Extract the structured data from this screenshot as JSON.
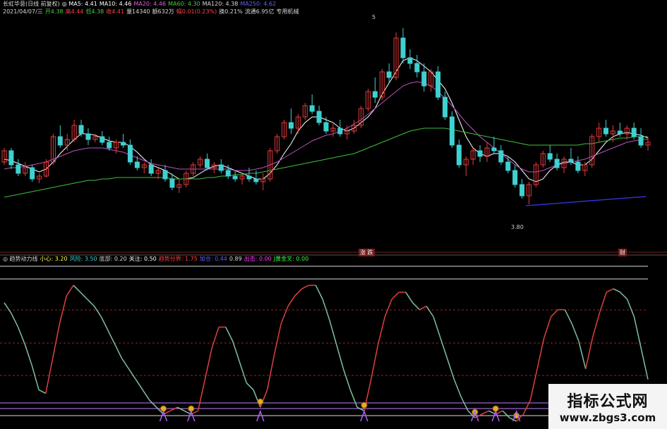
{
  "header": {
    "row1": [
      {
        "text": "长虹华意(日线 前复权)",
        "color": "#d8d8d8"
      },
      {
        "text": "◎ MA5: 4.41",
        "color": "#ffffff"
      },
      {
        "text": "MA10: 4.46",
        "color": "#ffffff"
      },
      {
        "text": "MA20: 4.46",
        "color": "#e060e0"
      },
      {
        "text": "MA60: 4.30",
        "color": "#40d040"
      },
      {
        "text": "MA120: 4.38",
        "color": "#d8d8d8"
      },
      {
        "text": "MA250: 4.62",
        "color": "#6060ff"
      }
    ],
    "row2": [
      {
        "text": "2021/04/07/三",
        "color": "#d8d8d8"
      },
      {
        "text": "开4.38",
        "color": "#40d040"
      },
      {
        "text": "高4.44",
        "color": "#ff4040"
      },
      {
        "text": "低4.38",
        "color": "#40d040"
      },
      {
        "text": "收4.41",
        "color": "#ff4040"
      },
      {
        "text": "量14340",
        "color": "#d8d8d8"
      },
      {
        "text": "额632万",
        "color": "#d8d8d8"
      },
      {
        "text": "幅0.01(0.23%)",
        "color": "#ff4040"
      },
      {
        "text": "换0.21%",
        "color": "#d8d8d8"
      },
      {
        "text": "流通6.95亿",
        "color": "#d8d8d8"
      },
      {
        "text": "专用机械",
        "color": "#d8d8d8"
      }
    ],
    "row3": [
      {
        "text": "◎ 趋势动力线",
        "color": "#d8d8d8"
      },
      {
        "text": "小心: 3.20",
        "color": "#ffff40"
      },
      {
        "text": "风险: 3.50",
        "color": "#40d0d0"
      },
      {
        "text": "底部: 0.20",
        "color": "#d8d8d8"
      },
      {
        "text": "关注: 0.50",
        "color": "#ffffff"
      },
      {
        "text": "趋势分界: 1.75",
        "color": "#ff4040"
      },
      {
        "text": "加仓: 0.44",
        "color": "#6060ff"
      },
      {
        "text": "0.89",
        "color": "#d8d8d8"
      },
      {
        "text": "出击: 0.00",
        "color": "#ff40ff"
      },
      {
        "text": "J黄金叉: 0.00",
        "color": "#40ff40"
      }
    ]
  },
  "price_high_label": "5",
  "price_low_label": "3.80",
  "badge_a": "涨 跌",
  "badge_b": "财",
  "watermark": {
    "title": "指标公式网",
    "url": "www.zbgs3.com"
  },
  "colors": {
    "up": "#e23b3b",
    "down": "#3fd0d0",
    "ma5": "#ffffff",
    "ma10": "#e0a0a0",
    "ma20": "#c050c0",
    "ma60": "#40c040",
    "ma250": "#3030d0",
    "ind_up": "#e04040",
    "ind_down": "#80c0a0"
  },
  "chart_data": [
    {
      "type": "candlestick",
      "title": "长虹华意(日线 前复权)",
      "ylim": [
        3.6,
        5.1
      ],
      "candles": [
        [
          4.1,
          4.2,
          4.08,
          4.18
        ],
        [
          4.18,
          4.2,
          4.05,
          4.08
        ],
        [
          4.08,
          4.12,
          4.0,
          4.02
        ],
        [
          4.02,
          4.1,
          4.0,
          4.06
        ],
        [
          4.06,
          4.08,
          3.96,
          3.98
        ],
        [
          3.98,
          4.02,
          3.95,
          4.0
        ],
        [
          4.0,
          4.12,
          3.99,
          4.1
        ],
        [
          4.1,
          4.3,
          4.08,
          4.28
        ],
        [
          4.28,
          4.36,
          4.2,
          4.22
        ],
        [
          4.22,
          4.3,
          4.18,
          4.26
        ],
        [
          4.26,
          4.4,
          4.24,
          4.36
        ],
        [
          4.36,
          4.4,
          4.28,
          4.3
        ],
        [
          4.3,
          4.34,
          4.22,
          4.26
        ],
        [
          4.26,
          4.3,
          4.24,
          4.28
        ],
        [
          4.28,
          4.32,
          4.22,
          4.24
        ],
        [
          4.24,
          4.28,
          4.18,
          4.2
        ],
        [
          4.2,
          4.26,
          4.16,
          4.24
        ],
        [
          4.24,
          4.3,
          4.2,
          4.22
        ],
        [
          4.22,
          4.26,
          4.08,
          4.1
        ],
        [
          4.1,
          4.14,
          4.04,
          4.06
        ],
        [
          4.06,
          4.1,
          4.02,
          4.08
        ],
        [
          4.08,
          4.12,
          4.0,
          4.02
        ],
        [
          4.02,
          4.06,
          3.98,
          4.04
        ],
        [
          4.04,
          4.08,
          3.96,
          3.98
        ],
        [
          3.98,
          4.02,
          3.9,
          3.92
        ],
        [
          3.92,
          3.98,
          3.88,
          3.94
        ],
        [
          3.94,
          4.04,
          3.92,
          4.02
        ],
        [
          4.02,
          4.1,
          4.0,
          4.08
        ],
        [
          4.08,
          4.14,
          4.06,
          4.12
        ],
        [
          4.12,
          4.16,
          4.04,
          4.06
        ],
        [
          4.06,
          4.1,
          4.02,
          4.08
        ],
        [
          4.08,
          4.12,
          4.02,
          4.04
        ],
        [
          4.04,
          4.08,
          3.98,
          4.0
        ],
        [
          4.0,
          4.04,
          3.96,
          3.98
        ],
        [
          3.98,
          4.02,
          3.94,
          4.0
        ],
        [
          4.0,
          4.06,
          3.96,
          3.98
        ],
        [
          3.98,
          4.04,
          3.94,
          3.96
        ],
        [
          3.96,
          4.02,
          3.9,
          3.98
        ],
        [
          3.98,
          4.2,
          3.96,
          4.18
        ],
        [
          4.18,
          4.3,
          4.16,
          4.28
        ],
        [
          4.28,
          4.4,
          4.26,
          4.38
        ],
        [
          4.38,
          4.48,
          4.3,
          4.34
        ],
        [
          4.34,
          4.44,
          4.3,
          4.42
        ],
        [
          4.42,
          4.52,
          4.4,
          4.5
        ],
        [
          4.5,
          4.58,
          4.44,
          4.46
        ],
        [
          4.46,
          4.5,
          4.36,
          4.38
        ],
        [
          4.38,
          4.42,
          4.3,
          4.32
        ],
        [
          4.32,
          4.38,
          4.28,
          4.34
        ],
        [
          4.34,
          4.4,
          4.28,
          4.3
        ],
        [
          4.3,
          4.36,
          4.26,
          4.32
        ],
        [
          4.32,
          4.4,
          4.3,
          4.36
        ],
        [
          4.36,
          4.5,
          4.34,
          4.48
        ],
        [
          4.48,
          4.62,
          4.46,
          4.6
        ],
        [
          4.6,
          4.7,
          4.52,
          4.56
        ],
        [
          4.56,
          4.76,
          4.54,
          4.74
        ],
        [
          4.74,
          4.8,
          4.66,
          4.7
        ],
        [
          4.7,
          5.02,
          4.68,
          4.98
        ],
        [
          4.98,
          5.05,
          4.8,
          4.84
        ],
        [
          4.84,
          4.9,
          4.76,
          4.8
        ],
        [
          4.8,
          4.86,
          4.7,
          4.74
        ],
        [
          4.74,
          4.8,
          4.6,
          4.64
        ],
        [
          4.64,
          4.76,
          4.6,
          4.74
        ],
        [
          4.74,
          4.78,
          4.54,
          4.56
        ],
        [
          4.56,
          4.6,
          4.4,
          4.42
        ],
        [
          4.42,
          4.46,
          4.2,
          4.22
        ],
        [
          4.22,
          4.26,
          4.06,
          4.08
        ],
        [
          4.08,
          4.14,
          4.0,
          4.12
        ],
        [
          4.12,
          4.2,
          4.08,
          4.18
        ],
        [
          4.18,
          4.22,
          4.1,
          4.14
        ],
        [
          4.14,
          4.24,
          4.1,
          4.2
        ],
        [
          4.2,
          4.28,
          4.16,
          4.18
        ],
        [
          4.18,
          4.22,
          4.08,
          4.1
        ],
        [
          4.1,
          4.14,
          4.02,
          4.04
        ],
        [
          4.04,
          4.08,
          3.92,
          3.94
        ],
        [
          3.94,
          3.98,
          3.84,
          3.86
        ],
        [
          3.86,
          3.96,
          3.8,
          3.94
        ],
        [
          3.94,
          4.1,
          3.92,
          4.08
        ],
        [
          4.08,
          4.18,
          4.06,
          4.16
        ],
        [
          4.16,
          4.22,
          4.1,
          4.12
        ],
        [
          4.12,
          4.16,
          4.04,
          4.06
        ],
        [
          4.06,
          4.14,
          4.02,
          4.12
        ],
        [
          4.12,
          4.2,
          4.08,
          4.1
        ],
        [
          4.1,
          4.14,
          4.02,
          4.04
        ],
        [
          4.04,
          4.1,
          4.0,
          4.08
        ],
        [
          4.08,
          4.3,
          4.06,
          4.28
        ],
        [
          4.28,
          4.38,
          4.24,
          4.34
        ],
        [
          4.34,
          4.4,
          4.28,
          4.3
        ],
        [
          4.3,
          4.36,
          4.24,
          4.32
        ],
        [
          4.32,
          4.38,
          4.28,
          4.3
        ],
        [
          4.3,
          4.36,
          4.26,
          4.34
        ],
        [
          4.34,
          4.38,
          4.26,
          4.28
        ],
        [
          4.28,
          4.34,
          4.2,
          4.22
        ],
        [
          4.22,
          4.28,
          4.18,
          4.24
        ]
      ],
      "ma_series": [
        {
          "name": "MA5",
          "values": [
            4.12,
            4.11,
            4.09,
            4.07,
            4.05,
            4.03,
            4.05,
            4.1,
            4.16,
            4.21,
            4.26,
            4.3,
            4.3,
            4.29,
            4.27,
            4.25,
            4.24,
            4.24,
            4.21,
            4.17,
            4.12,
            4.08,
            4.06,
            4.04,
            4.01,
            3.98,
            3.98,
            3.99,
            4.02,
            4.05,
            4.07,
            4.08,
            4.06,
            4.04,
            4.02,
            4.0,
            3.98,
            3.98,
            4.02,
            4.08,
            4.16,
            4.23,
            4.32,
            4.38,
            4.42,
            4.42,
            4.4,
            4.38,
            4.34,
            4.32,
            4.34,
            4.38,
            4.42,
            4.48,
            4.58,
            4.66,
            4.74,
            4.82,
            4.84,
            4.82,
            4.78,
            4.74,
            4.68,
            4.62,
            4.52,
            4.4,
            4.28,
            4.2,
            4.16,
            4.14,
            4.16,
            4.16,
            4.14,
            4.1,
            4.04,
            3.98,
            3.96,
            3.98,
            4.04,
            4.08,
            4.1,
            4.1,
            4.08,
            4.08,
            4.12,
            4.18,
            4.24,
            4.28,
            4.3,
            4.31,
            4.3,
            4.29,
            4.27
          ]
        },
        {
          "name": "MA20",
          "values": [
            4.05,
            4.06,
            4.06,
            4.07,
            4.08,
            4.09,
            4.1,
            4.12,
            4.14,
            4.16,
            4.18,
            4.19,
            4.2,
            4.2,
            4.2,
            4.19,
            4.18,
            4.17,
            4.15,
            4.13,
            4.11,
            4.09,
            4.08,
            4.07,
            4.06,
            4.05,
            4.05,
            4.05,
            4.05,
            4.05,
            4.05,
            4.05,
            4.05,
            4.04,
            4.04,
            4.04,
            4.05,
            4.06,
            4.08,
            4.1,
            4.13,
            4.16,
            4.19,
            4.22,
            4.25,
            4.27,
            4.29,
            4.3,
            4.32,
            4.34,
            4.37,
            4.4,
            4.44,
            4.48,
            4.52,
            4.56,
            4.6,
            4.64,
            4.66,
            4.67,
            4.66,
            4.64,
            4.6,
            4.55,
            4.5,
            4.44,
            4.38,
            4.33,
            4.28,
            4.24,
            4.2,
            4.16,
            4.12,
            4.08,
            4.05,
            4.03,
            4.03,
            4.04,
            4.06,
            4.08,
            4.09,
            4.1,
            4.11,
            4.12,
            4.14,
            4.16,
            4.18,
            4.2,
            4.22,
            4.24,
            4.25,
            4.26,
            4.26
          ]
        },
        {
          "name": "MA60",
          "values": [
            3.85,
            3.86,
            3.87,
            3.88,
            3.89,
            3.9,
            3.91,
            3.92,
            3.93,
            3.94,
            3.95,
            3.96,
            3.97,
            3.97,
            3.98,
            3.98,
            3.99,
            3.99,
            3.99,
            3.99,
            3.99,
            3.99,
            3.99,
            3.99,
            3.98,
            3.98,
            3.98,
            3.98,
            3.98,
            3.99,
            3.99,
            4.0,
            4.0,
            4.01,
            4.01,
            4.02,
            4.02,
            4.03,
            4.04,
            4.05,
            4.06,
            4.07,
            4.08,
            4.09,
            4.1,
            4.11,
            4.12,
            4.13,
            4.14,
            4.15,
            4.16,
            4.18,
            4.2,
            4.22,
            4.24,
            4.26,
            4.28,
            4.3,
            4.32,
            4.33,
            4.34,
            4.34,
            4.34,
            4.34,
            4.33,
            4.32,
            4.31,
            4.3,
            4.29,
            4.28,
            4.27,
            4.26,
            4.25,
            4.24,
            4.23,
            4.22,
            4.22,
            4.22,
            4.22,
            4.22,
            4.22,
            4.22,
            4.22,
            4.23,
            4.23,
            4.24,
            4.25,
            4.26,
            4.27,
            4.27,
            4.28,
            4.28,
            4.28
          ]
        }
      ]
    },
    {
      "type": "line",
      "title": "趋势动力线",
      "ylim": [
        0,
        4
      ],
      "values": [
        3.4,
        3.1,
        2.7,
        2.2,
        1.6,
        0.9,
        0.8,
        1.8,
        2.8,
        3.6,
        3.9,
        3.7,
        3.5,
        3.3,
        3.0,
        2.6,
        2.2,
        1.8,
        1.5,
        1.2,
        0.9,
        0.6,
        0.4,
        0.2,
        0.3,
        0.4,
        0.3,
        0.2,
        0.3,
        1.2,
        2.1,
        2.7,
        2.7,
        2.3,
        1.7,
        1.1,
        0.9,
        0.4,
        0.9,
        1.9,
        2.8,
        3.3,
        3.6,
        3.8,
        3.9,
        3.9,
        3.5,
        2.9,
        2.2,
        1.5,
        0.9,
        0.4,
        0.3,
        1.2,
        2.2,
        3.0,
        3.5,
        3.7,
        3.7,
        3.4,
        3.2,
        3.3,
        3.0,
        2.4,
        1.8,
        1.2,
        0.7,
        0.3,
        0.1,
        0.2,
        0.3,
        0.2,
        0.3,
        0.1,
        0.0,
        0.2,
        0.6,
        1.5,
        2.4,
        3.0,
        3.2,
        3.2,
        2.8,
        2.3,
        1.5,
        2.4,
        3.1,
        3.7,
        3.8,
        3.7,
        3.5,
        3.0,
        2.1,
        1.2
      ]
    }
  ]
}
